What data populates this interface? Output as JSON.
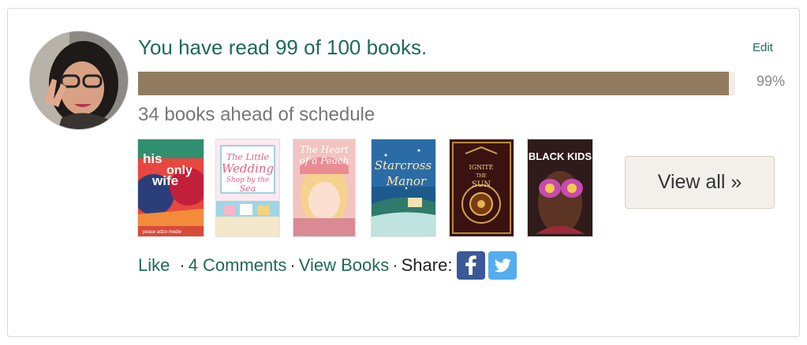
{
  "challenge": {
    "headline": "You have read 99 of 100 books.",
    "edit_label": "Edit",
    "progress_fraction": 0.99,
    "progress_label": "99%",
    "schedule_text": "34 books ahead of schedule"
  },
  "books": [
    {
      "cover_lines": [
        "his",
        "only",
        "wife"
      ],
      "bottom_text": "peace adzo medie"
    },
    {
      "cover_lines": [
        "The Little",
        "Wedding",
        "Shop by the",
        "Sea"
      ]
    },
    {
      "cover_lines": [
        "The Heart",
        "of a Peach"
      ]
    },
    {
      "cover_lines": [
        "Starcross",
        "Manor"
      ]
    },
    {
      "cover_lines": [
        "IGNITE",
        "THE",
        "SUN"
      ]
    },
    {
      "cover_lines": [
        "BLACK KIDS"
      ]
    }
  ],
  "view_all_label": "View all »",
  "actions": {
    "like": "Like",
    "comments": "4 Comments",
    "view_books": "View Books",
    "share": "Share:"
  },
  "social": [
    {
      "icon": "facebook-icon",
      "color": "#3b5998"
    },
    {
      "icon": "twitter-icon",
      "color": "#55acee"
    }
  ],
  "colors": {
    "link": "#1e6a59",
    "progress_fill": "#917c60",
    "progress_track": "#f1eee8",
    "muted": "#777777"
  }
}
